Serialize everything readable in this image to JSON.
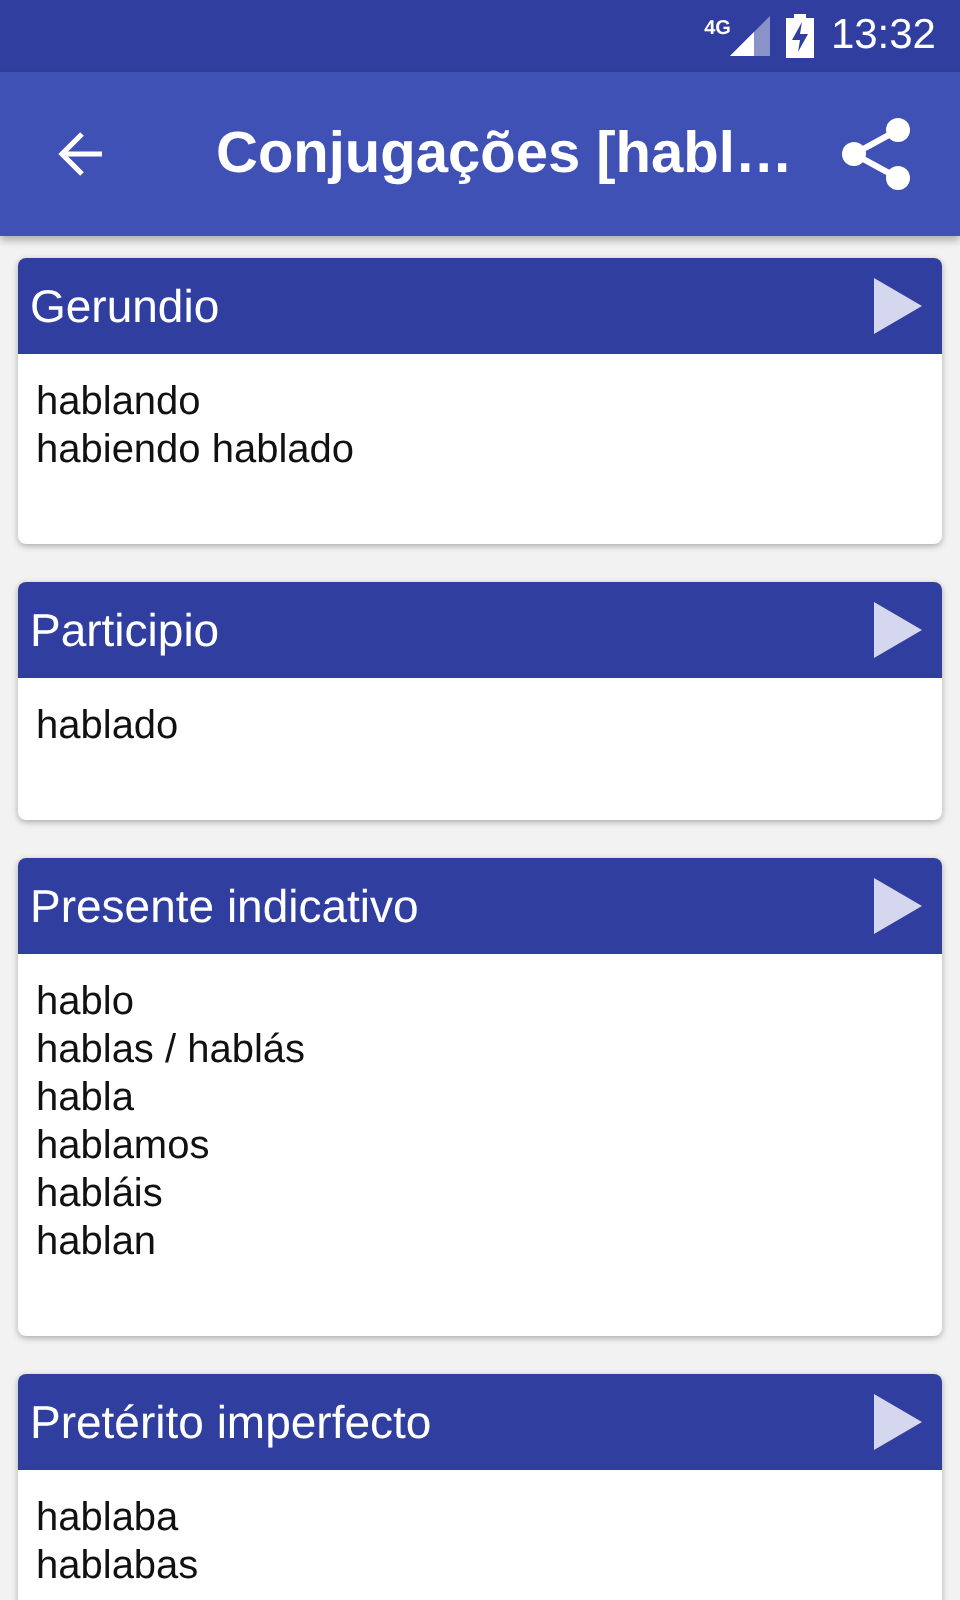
{
  "status_bar": {
    "network": "4G",
    "time": "13:32"
  },
  "app_bar": {
    "title": "Conjugações [habl…"
  },
  "sections": [
    {
      "title": "Gerundio",
      "forms": [
        "hablando",
        "habiendo hablado"
      ]
    },
    {
      "title": "Participio",
      "forms": [
        "hablado"
      ]
    },
    {
      "title": "Presente indicativo",
      "forms": [
        "hablo",
        "hablas / hablás",
        "habla",
        "hablamos",
        "habláis",
        "hablan"
      ]
    },
    {
      "title": "Pretérito imperfecto",
      "forms": [
        "hablaba",
        "hablabas"
      ]
    }
  ]
}
